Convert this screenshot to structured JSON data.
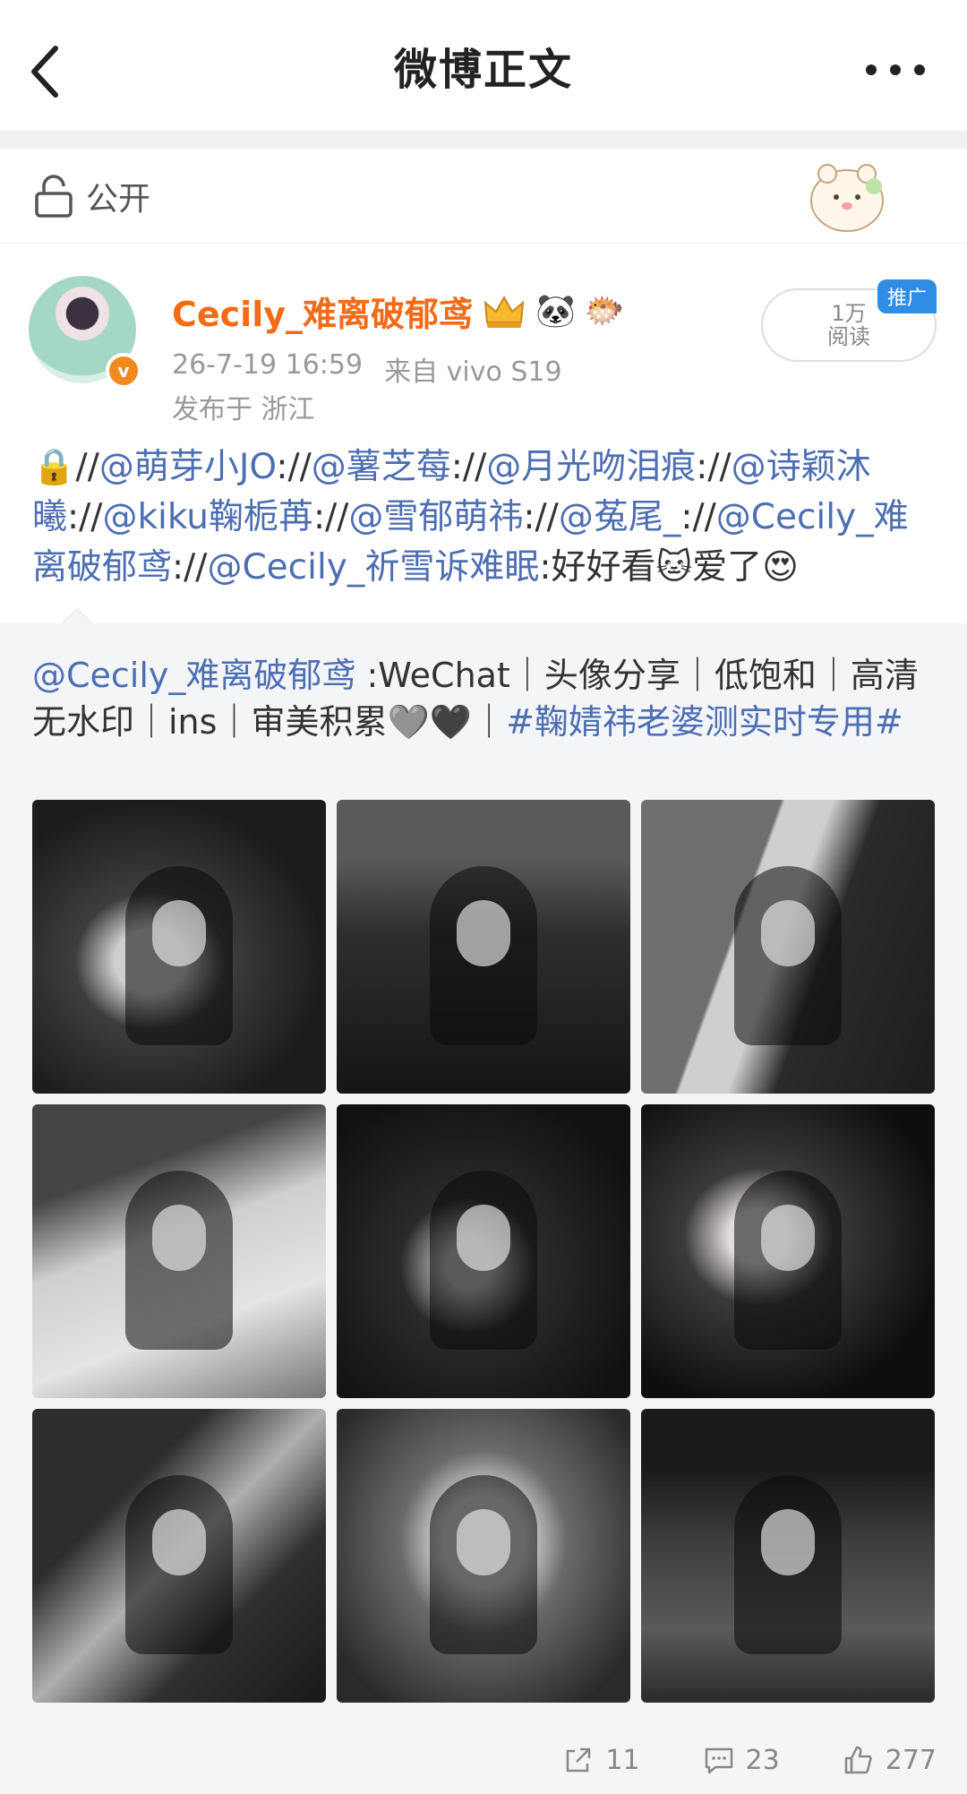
{
  "header": {
    "title": "微博正文"
  },
  "visibility": {
    "label": "公开"
  },
  "post": {
    "username": "Cecily_难离破郁鸢",
    "emojis": [
      "🐼",
      "🐡"
    ],
    "avatar_badge": "v",
    "timestamp": "26-7-19 16:59",
    "source": "来自 vivo S19",
    "location": "发布于 浙江",
    "reads": {
      "count": "1万",
      "label": "阅读",
      "promo_label": "推广"
    },
    "repost_segments": [
      {
        "text": "🔒//",
        "type": "text"
      },
      {
        "text": "@萌芽小JO",
        "type": "mention"
      },
      {
        "text": "://",
        "type": "text"
      },
      {
        "text": "@薯芝莓",
        "type": "mention"
      },
      {
        "text": "://",
        "type": "text"
      },
      {
        "text": "@月光吻泪痕",
        "type": "mention"
      },
      {
        "text": "://",
        "type": "text"
      },
      {
        "text": "@诗颖沐曦",
        "type": "mention"
      },
      {
        "text": "://",
        "type": "text"
      },
      {
        "text": "@kiku鞠栀苒",
        "type": "mention"
      },
      {
        "text": "://",
        "type": "text"
      },
      {
        "text": "@雪郁萌祎",
        "type": "mention"
      },
      {
        "text": "://",
        "type": "text"
      },
      {
        "text": "@菟尾_",
        "type": "mention"
      },
      {
        "text": "://",
        "type": "text"
      },
      {
        "text": "@Cecily_难离破郁鸢",
        "type": "mention"
      },
      {
        "text": "://",
        "type": "text"
      },
      {
        "text": "@Cecily_祈雪诉难眠",
        "type": "mention"
      },
      {
        "text": ":好好看🐱爱了😍",
        "type": "text"
      }
    ]
  },
  "original": {
    "segments": [
      {
        "text": "@Cecily_难离破郁鸢",
        "type": "mention"
      },
      {
        "text": " :WeChat｜头像分享｜低饱和｜高清无水印｜ins｜审美积累🩶🖤｜",
        "type": "text"
      },
      {
        "text": "#鞠婧祎老婆测实时专用#",
        "type": "tag"
      }
    ],
    "photo_count": 9
  },
  "actions": {
    "reposts": "11",
    "comments": "23",
    "likes": "277"
  },
  "colors": {
    "username": "#f36b16",
    "mention": "#4d6eb3",
    "promo": "#2f8de4",
    "original_bg": "#f4f5f7"
  },
  "icons": [
    "back-icon",
    "more-icon",
    "lock-icon",
    "vip-crown-icon",
    "repost-icon",
    "comment-icon",
    "like-icon"
  ]
}
